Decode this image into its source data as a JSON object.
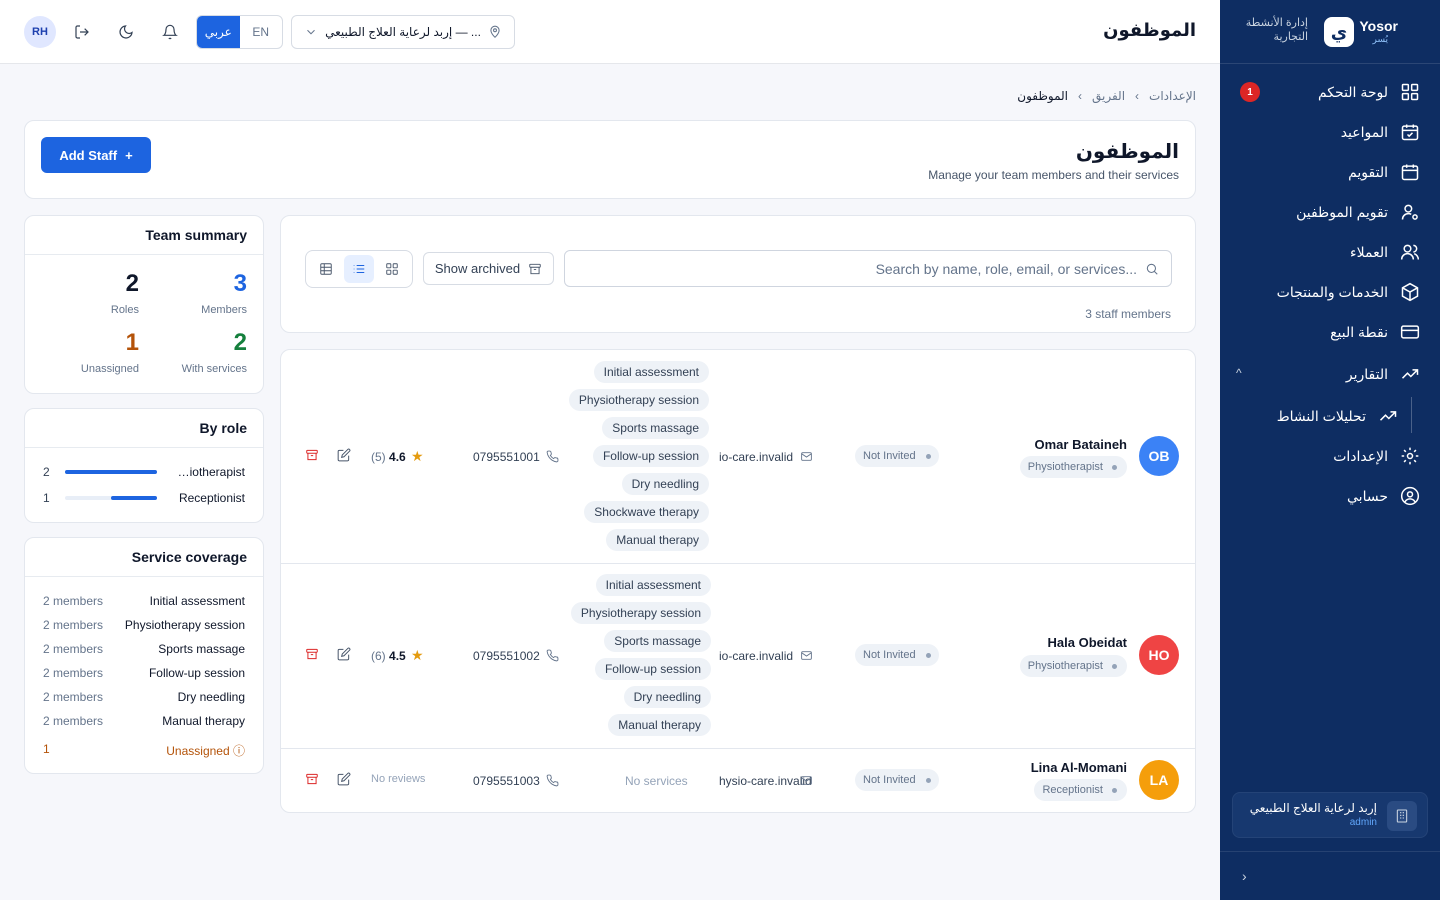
{
  "sidebar": {
    "brand_name": "Yosor",
    "brand_sub": "يُسر",
    "brand_logo": "ي",
    "brand_tag": "إدارة الأنشطة التجارية",
    "badge_count": "1",
    "items": [
      {
        "label": "لوحة التحكم",
        "icon": "grid-icon"
      },
      {
        "label": "المواعيد",
        "icon": "calendar-check-icon"
      },
      {
        "label": "التقويم",
        "icon": "calendar-icon"
      },
      {
        "label": "تقويم الموظفين",
        "icon": "user-gear-icon"
      },
      {
        "label": "العملاء",
        "icon": "users-icon"
      },
      {
        "label": "الخدمات والمنتجات",
        "icon": "box-icon"
      },
      {
        "label": "نقطة البيع",
        "icon": "credit-card-icon"
      },
      {
        "label": "التقارير",
        "icon": "trending-up-icon"
      },
      {
        "label": "تحليلات النشاط",
        "icon": "trending-up-icon"
      },
      {
        "label": "الإعدادات",
        "icon": "gear-icon"
      },
      {
        "label": "حسابي",
        "icon": "user-circle-icon"
      }
    ],
    "org_name": "إربد لرعاية العلاج الطبيعي",
    "org_role": "admin"
  },
  "header": {
    "title": "الموظفون",
    "avatar": "RH",
    "lang_active": "عربي",
    "lang_other": "EN",
    "location": "إربد لرعاية العلاج الطبيعي — ..."
  },
  "breadcrumb": [
    "الإعدادات",
    "الفريق",
    "الموظفون"
  ],
  "page": {
    "title": "الموظفون",
    "subtitle": "Manage your team members and their services",
    "add_label": "Add Staff"
  },
  "summary": {
    "title": "Team summary",
    "members": "3",
    "members_label": "Members",
    "roles": "2",
    "roles_label": "Roles",
    "with_services": "2",
    "with_services_label": "With services",
    "unassigned": "1",
    "unassigned_label": "Unassigned"
  },
  "by_role": {
    "title": "By role",
    "rows": [
      {
        "name": "Physiotherapist",
        "count": "2",
        "fraction": 1.0
      },
      {
        "name": "Receptionist",
        "count": "1",
        "fraction": 0.5
      }
    ]
  },
  "coverage": {
    "title": "Service coverage",
    "rows": [
      {
        "name": "Initial assessment",
        "members": "2 members"
      },
      {
        "name": "Physiotherapy session",
        "members": "2 members"
      },
      {
        "name": "Sports massage",
        "members": "2 members"
      },
      {
        "name": "Follow-up session",
        "members": "2 members"
      },
      {
        "name": "Dry needling",
        "members": "2 members"
      },
      {
        "name": "Manual therapy",
        "members": "2 members"
      }
    ],
    "unassigned_label": "Unassigned",
    "unassigned_count": "1"
  },
  "toolbar": {
    "search_placeholder": "Search by name, role, email, or services...",
    "show_archived": "Show archived",
    "count": "3 staff members"
  },
  "staff": [
    {
      "initials": "OB",
      "color": "#3b82f6",
      "name": "Omar Bataineh",
      "role": "Physiotherapist",
      "status": "Not Invited",
      "email": "io-care.invalid",
      "phone": "0795551001",
      "rating": "4.6",
      "reviews": "(5)",
      "services": [
        "Initial assessment",
        "Physiotherapy session",
        "Sports massage",
        "Follow-up session",
        "Dry needling",
        "Shockwave therapy",
        "Manual therapy"
      ]
    },
    {
      "initials": "HO",
      "color": "#ef4444",
      "name": "Hala Obeidat",
      "role": "Physiotherapist",
      "status": "Not Invited",
      "email": "io-care.invalid",
      "phone": "0795551002",
      "rating": "4.5",
      "reviews": "(6)",
      "services": [
        "Initial assessment",
        "Physiotherapy session",
        "Sports massage",
        "Follow-up session",
        "Dry needling",
        "Manual therapy"
      ]
    },
    {
      "initials": "LA",
      "color": "#f59e0b",
      "name": "Lina Al-Momani",
      "role": "Receptionist",
      "status": "Not Invited",
      "email": "hysio-care.invalid",
      "phone": "0795551003",
      "no_reviews": "No reviews",
      "no_services": "No services"
    }
  ]
}
